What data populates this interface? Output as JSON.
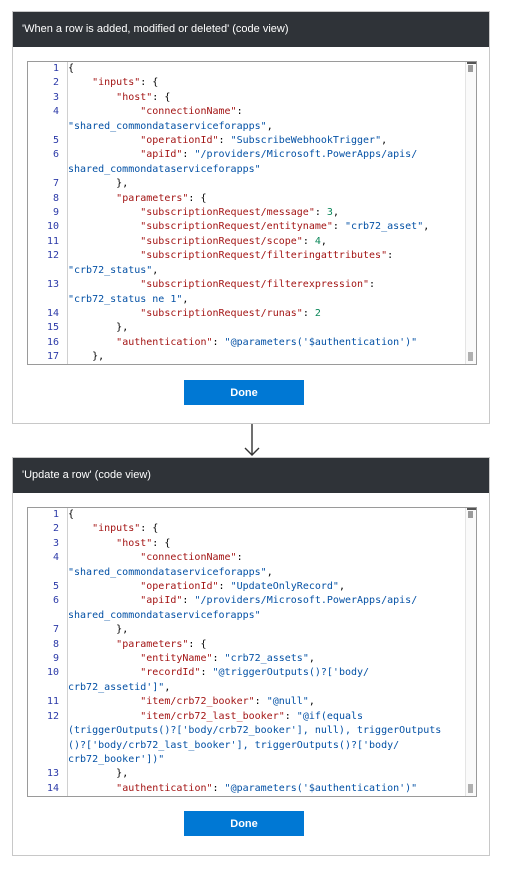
{
  "trigger_card": {
    "title": "'When a row is added, modified or deleted' (code view)",
    "done_label": "Done",
    "lines": [
      {
        "num": "1",
        "segs": [
          [
            {
              "t": "{",
              "c": "pun"
            }
          ]
        ]
      },
      {
        "num": "2",
        "segs": [
          [
            {
              "t": "    ",
              "c": "pun"
            },
            {
              "t": "\"inputs\"",
              "c": "key"
            },
            {
              "t": ": {",
              "c": "pun"
            }
          ]
        ]
      },
      {
        "num": "3",
        "segs": [
          [
            {
              "t": "        ",
              "c": "pun"
            },
            {
              "t": "\"host\"",
              "c": "key"
            },
            {
              "t": ": {",
              "c": "pun"
            }
          ]
        ]
      },
      {
        "num": "4",
        "segs": [
          [
            {
              "t": "            ",
              "c": "pun"
            },
            {
              "t": "\"connectionName\"",
              "c": "key"
            },
            {
              "t": ":",
              "c": "pun"
            }
          ],
          [
            {
              "t": "\"shared_commondataserviceforapps\"",
              "c": "str"
            },
            {
              "t": ",",
              "c": "pun"
            }
          ]
        ]
      },
      {
        "num": "5",
        "segs": [
          [
            {
              "t": "            ",
              "c": "pun"
            },
            {
              "t": "\"operationId\"",
              "c": "key"
            },
            {
              "t": ": ",
              "c": "pun"
            },
            {
              "t": "\"SubscribeWebhookTrigger\"",
              "c": "str"
            },
            {
              "t": ",",
              "c": "pun"
            }
          ]
        ]
      },
      {
        "num": "6",
        "segs": [
          [
            {
              "t": "            ",
              "c": "pun"
            },
            {
              "t": "\"apiId\"",
              "c": "key"
            },
            {
              "t": ": ",
              "c": "pun"
            },
            {
              "t": "\"/providers/Microsoft.PowerApps/apis/",
              "c": "str"
            }
          ],
          [
            {
              "t": "shared_commondataserviceforapps\"",
              "c": "str"
            }
          ]
        ]
      },
      {
        "num": "7",
        "segs": [
          [
            {
              "t": "        },",
              "c": "pun"
            }
          ]
        ]
      },
      {
        "num": "8",
        "segs": [
          [
            {
              "t": "        ",
              "c": "pun"
            },
            {
              "t": "\"parameters\"",
              "c": "key"
            },
            {
              "t": ": {",
              "c": "pun"
            }
          ]
        ]
      },
      {
        "num": "9",
        "segs": [
          [
            {
              "t": "            ",
              "c": "pun"
            },
            {
              "t": "\"subscriptionRequest/message\"",
              "c": "key"
            },
            {
              "t": ": ",
              "c": "pun"
            },
            {
              "t": "3",
              "c": "num"
            },
            {
              "t": ",",
              "c": "pun"
            }
          ]
        ]
      },
      {
        "num": "10",
        "segs": [
          [
            {
              "t": "            ",
              "c": "pun"
            },
            {
              "t": "\"subscriptionRequest/entityname\"",
              "c": "key"
            },
            {
              "t": ": ",
              "c": "pun"
            },
            {
              "t": "\"crb72_asset\"",
              "c": "str"
            },
            {
              "t": ",",
              "c": "pun"
            }
          ]
        ]
      },
      {
        "num": "11",
        "segs": [
          [
            {
              "t": "            ",
              "c": "pun"
            },
            {
              "t": "\"subscriptionRequest/scope\"",
              "c": "key"
            },
            {
              "t": ": ",
              "c": "pun"
            },
            {
              "t": "4",
              "c": "num"
            },
            {
              "t": ",",
              "c": "pun"
            }
          ]
        ]
      },
      {
        "num": "12",
        "segs": [
          [
            {
              "t": "            ",
              "c": "pun"
            },
            {
              "t": "\"subscriptionRequest/filteringattributes\"",
              "c": "key"
            },
            {
              "t": ":",
              "c": "pun"
            }
          ],
          [
            {
              "t": "\"crb72_status\"",
              "c": "str"
            },
            {
              "t": ",",
              "c": "pun"
            }
          ]
        ]
      },
      {
        "num": "13",
        "segs": [
          [
            {
              "t": "            ",
              "c": "pun"
            },
            {
              "t": "\"subscriptionRequest/filterexpression\"",
              "c": "key"
            },
            {
              "t": ":",
              "c": "pun"
            }
          ],
          [
            {
              "t": "\"crb72_status ne 1\"",
              "c": "str"
            },
            {
              "t": ",",
              "c": "pun"
            }
          ]
        ]
      },
      {
        "num": "14",
        "segs": [
          [
            {
              "t": "            ",
              "c": "pun"
            },
            {
              "t": "\"subscriptionRequest/runas\"",
              "c": "key"
            },
            {
              "t": ": ",
              "c": "pun"
            },
            {
              "t": "2",
              "c": "num"
            }
          ]
        ]
      },
      {
        "num": "15",
        "segs": [
          [
            {
              "t": "        },",
              "c": "pun"
            }
          ]
        ]
      },
      {
        "num": "16",
        "segs": [
          [
            {
              "t": "        ",
              "c": "pun"
            },
            {
              "t": "\"authentication\"",
              "c": "key"
            },
            {
              "t": ": ",
              "c": "pun"
            },
            {
              "t": "\"@parameters('$authentication')\"",
              "c": "str"
            }
          ]
        ]
      },
      {
        "num": "17",
        "segs": [
          [
            {
              "t": "    },",
              "c": "pun"
            }
          ]
        ]
      }
    ]
  },
  "action_card": {
    "title": "'Update a row' (code view)",
    "done_label": "Done",
    "lines": [
      {
        "num": "1",
        "segs": [
          [
            {
              "t": "{",
              "c": "pun"
            }
          ]
        ]
      },
      {
        "num": "2",
        "segs": [
          [
            {
              "t": "    ",
              "c": "pun"
            },
            {
              "t": "\"inputs\"",
              "c": "key"
            },
            {
              "t": ": {",
              "c": "pun"
            }
          ]
        ]
      },
      {
        "num": "3",
        "segs": [
          [
            {
              "t": "        ",
              "c": "pun"
            },
            {
              "t": "\"host\"",
              "c": "key"
            },
            {
              "t": ": {",
              "c": "pun"
            }
          ]
        ]
      },
      {
        "num": "4",
        "segs": [
          [
            {
              "t": "            ",
              "c": "pun"
            },
            {
              "t": "\"connectionName\"",
              "c": "key"
            },
            {
              "t": ":",
              "c": "pun"
            }
          ],
          [
            {
              "t": "\"shared_commondataserviceforapps\"",
              "c": "str"
            },
            {
              "t": ",",
              "c": "pun"
            }
          ]
        ]
      },
      {
        "num": "5",
        "segs": [
          [
            {
              "t": "            ",
              "c": "pun"
            },
            {
              "t": "\"operationId\"",
              "c": "key"
            },
            {
              "t": ": ",
              "c": "pun"
            },
            {
              "t": "\"UpdateOnlyRecord\"",
              "c": "str"
            },
            {
              "t": ",",
              "c": "pun"
            }
          ]
        ]
      },
      {
        "num": "6",
        "segs": [
          [
            {
              "t": "            ",
              "c": "pun"
            },
            {
              "t": "\"apiId\"",
              "c": "key"
            },
            {
              "t": ": ",
              "c": "pun"
            },
            {
              "t": "\"/providers/Microsoft.PowerApps/apis/",
              "c": "str"
            }
          ],
          [
            {
              "t": "shared_commondataserviceforapps\"",
              "c": "str"
            }
          ]
        ]
      },
      {
        "num": "7",
        "segs": [
          [
            {
              "t": "        },",
              "c": "pun"
            }
          ]
        ]
      },
      {
        "num": "8",
        "segs": [
          [
            {
              "t": "        ",
              "c": "pun"
            },
            {
              "t": "\"parameters\"",
              "c": "key"
            },
            {
              "t": ": {",
              "c": "pun"
            }
          ]
        ]
      },
      {
        "num": "9",
        "segs": [
          [
            {
              "t": "            ",
              "c": "pun"
            },
            {
              "t": "\"entityName\"",
              "c": "key"
            },
            {
              "t": ": ",
              "c": "pun"
            },
            {
              "t": "\"crb72_assets\"",
              "c": "str"
            },
            {
              "t": ",",
              "c": "pun"
            }
          ]
        ]
      },
      {
        "num": "10",
        "segs": [
          [
            {
              "t": "            ",
              "c": "pun"
            },
            {
              "t": "\"recordId\"",
              "c": "key"
            },
            {
              "t": ": ",
              "c": "pun"
            },
            {
              "t": "\"@triggerOutputs()?['body/",
              "c": "str"
            }
          ],
          [
            {
              "t": "crb72_assetid']\"",
              "c": "str"
            },
            {
              "t": ",",
              "c": "pun"
            }
          ]
        ]
      },
      {
        "num": "11",
        "segs": [
          [
            {
              "t": "            ",
              "c": "pun"
            },
            {
              "t": "\"item/crb72_booker\"",
              "c": "key"
            },
            {
              "t": ": ",
              "c": "pun"
            },
            {
              "t": "\"@null\"",
              "c": "str"
            },
            {
              "t": ",",
              "c": "pun"
            }
          ]
        ]
      },
      {
        "num": "12",
        "segs": [
          [
            {
              "t": "            ",
              "c": "pun"
            },
            {
              "t": "\"item/crb72_last_booker\"",
              "c": "key"
            },
            {
              "t": ": ",
              "c": "pun"
            },
            {
              "t": "\"@if(equals",
              "c": "str"
            }
          ],
          [
            {
              "t": "(triggerOutputs()?['body/crb72_booker'], null), triggerOutputs",
              "c": "str"
            }
          ],
          [
            {
              "t": "()?['body/crb72_last_booker'], triggerOutputs()?['body/",
              "c": "str"
            }
          ],
          [
            {
              "t": "crb72_booker'])\"",
              "c": "str"
            }
          ]
        ]
      },
      {
        "num": "13",
        "segs": [
          [
            {
              "t": "        },",
              "c": "pun"
            }
          ]
        ]
      },
      {
        "num": "14",
        "segs": [
          [
            {
              "t": "        ",
              "c": "pun"
            },
            {
              "t": "\"authentication\"",
              "c": "key"
            },
            {
              "t": ": ",
              "c": "pun"
            },
            {
              "t": "\"@parameters('$authentication')\"",
              "c": "str"
            }
          ]
        ]
      }
    ]
  },
  "colors": {
    "header_bg": "#2f3338",
    "button_bg": "#0078d4",
    "key": "#a31515",
    "string": "#0451a5",
    "number": "#098658",
    "line_number": "#2c3aa8"
  }
}
